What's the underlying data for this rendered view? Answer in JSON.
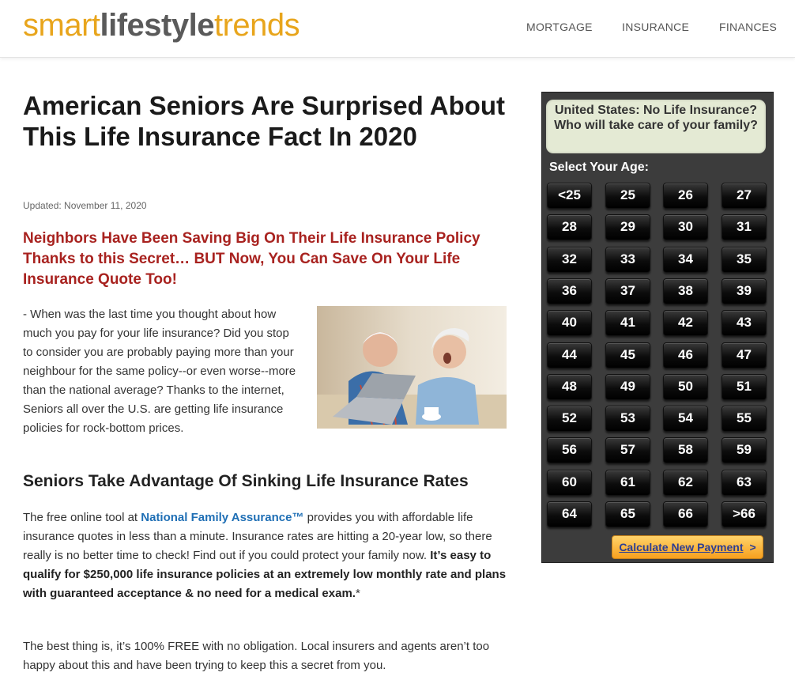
{
  "header": {
    "logo": {
      "part1": "smart",
      "part2": "lifestyle",
      "part3": "trends"
    },
    "nav": [
      "MORTGAGE",
      "INSURANCE",
      "FINANCES"
    ]
  },
  "article": {
    "headline": "American Seniors Are Surprised About This Life Insurance Fact In 2020",
    "updated": "Updated:  November 11, 2020",
    "subhead": "Neighbors Have Been Saving Big On Their Life Insurance Policy Thanks to this Secret… BUT Now, You Can Save On Your Life Insurance Quote Too!",
    "para1": "- When was the last time you thought about how much you pay for your life insurance? Did you stop to consider you are probably paying more than your neighbour for the same policy--or even worse--more than the national average? Thanks to the internet, Seniors all over the U.S. are getting life insurance policies for rock-bottom prices.",
    "h2": "Seniors Take Advantage Of Sinking Life Insurance Rates",
    "para2_pre": "The free online tool at ",
    "para2_link": "National Family Assurance™",
    "para2_mid": " provides you with affordable life insurance quotes in less than a minute. Insurance rates are hitting a 20-year low, so there really is no better time to check! Find out if you could protect your family now. ",
    "para2_bold": "It’s easy to qualify for $250,000 life insurance policies at an extremely low monthly rate and plans with guaranteed acceptance & no need for a medical exam.",
    "para2_post": "*",
    "para3": "The best thing is, it’s 100% FREE with no obligation. Local insurers and agents aren’t too happy about this and have been trying to keep this a secret from you."
  },
  "widget": {
    "question": "United States: No Life Insurance? Who will take care of your family?",
    "select_label": "Select Your Age:",
    "ages": [
      "<25",
      "25",
      "26",
      "27",
      "28",
      "29",
      "30",
      "31",
      "32",
      "33",
      "34",
      "35",
      "36",
      "37",
      "38",
      "39",
      "40",
      "41",
      "42",
      "43",
      "44",
      "45",
      "46",
      "47",
      "48",
      "49",
      "50",
      "51",
      "52",
      "53",
      "54",
      "55",
      "56",
      "57",
      "58",
      "59",
      "60",
      "61",
      "62",
      "63",
      "64",
      "65",
      "66",
      ">66"
    ],
    "calc_label": "Calculate New Payment",
    "calc_arrow": ">"
  }
}
